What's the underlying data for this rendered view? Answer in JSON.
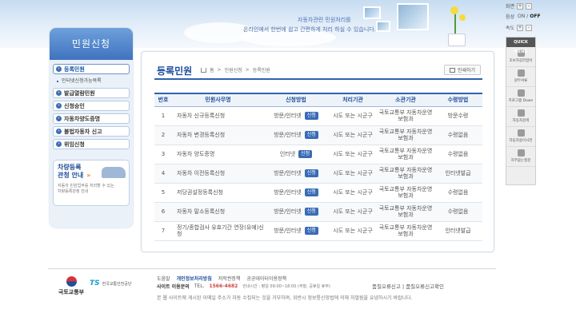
{
  "header": {
    "subtitle": "자동차관련 민원처리를",
    "headline": "온라인에서 한번에 쉽고 간편하게 처리 하실 수 있습니다."
  },
  "sidebar": {
    "title": "민원신청",
    "items": [
      {
        "label": "등록민원"
      },
      {
        "label": "발급열람민원"
      },
      {
        "label": "신청승인"
      },
      {
        "label": "자동차양도증명"
      },
      {
        "label": "불법자동차 신고"
      },
      {
        "label": "위임신청"
      }
    ],
    "sub_item": "인터넷신청가능목록",
    "promo": {
      "title_line1": "차량등록",
      "title_line2": "관청 안내",
      "arrow": "»",
      "desc_line1": "자동차 민원업무를 처리할 수 있는",
      "desc_line2": "차량등록관청 안내"
    }
  },
  "main": {
    "title": "등록민원",
    "breadcrumb": [
      "홈",
      ">",
      "민원신청",
      ">",
      "등록민원"
    ],
    "print_label": "인쇄하기",
    "apply_label": "신청",
    "columns": [
      "번호",
      "민원사무명",
      "신청방법",
      "처리기관",
      "소관기관",
      "수령방법"
    ],
    "rows": [
      {
        "no": "1",
        "name": "자동차 신규등록신청",
        "method": "방문/인터넷",
        "org": "시도 또는 시군구",
        "owner": "국토교통부 자동차운영보험과",
        "receive": "방문수령"
      },
      {
        "no": "2",
        "name": "자동차 변경등록신청",
        "method": "방문/인터넷",
        "org": "시도 또는 시군구",
        "owner": "국토교통부 자동차운영보험과",
        "receive": "수령없음"
      },
      {
        "no": "3",
        "name": "자동차 양도증명",
        "method": "인터넷",
        "org": "시도 또는 시군구",
        "owner": "국토교통부 자동차운영보험과",
        "receive": "수령없음"
      },
      {
        "no": "4",
        "name": "자동차 이전등록신청",
        "method": "방문/인터넷",
        "org": "시도 또는 시군구",
        "owner": "국토교통부 자동차운영보험과",
        "receive": "인터넷발급"
      },
      {
        "no": "5",
        "name": "저당권설정등록신청",
        "method": "방문/인터넷",
        "org": "시도 또는 시군구",
        "owner": "국토교통부 자동차운영보험과",
        "receive": "수령없음"
      },
      {
        "no": "6",
        "name": "자동차 말소등록신청",
        "method": "방문/인터넷",
        "org": "시도 또는 시군구",
        "owner": "국토교통부 자동차운영보험과",
        "receive": "수령없음"
      },
      {
        "no": "7",
        "name": "정기/종합검사 유효기간 연장(유예)신청",
        "method": "방문/인터넷",
        "org": "시도 또는 시군구",
        "owner": "국토교통부 자동차운영보험과",
        "receive": "인터넷발급"
      }
    ]
  },
  "rightbar": {
    "zoom_label": "화면",
    "plus": "+",
    "minus": "-",
    "voice_label": "음성",
    "voice_on": "ON",
    "voice_off": "OFF",
    "speed_label": "속도",
    "quick_title": "QUICK MENU",
    "quick_items": [
      "초보자길라잡이",
      "원부서류",
      "프로그램 Down",
      "자동차검색",
      "자동차용어사전",
      "자주묻는질문"
    ]
  },
  "footer": {
    "logo1": "국토교통부",
    "logo2_mark": "TS",
    "logo2_text": "한국교통안전공단",
    "links": [
      "도움말",
      "개인정보처리방침",
      "저작권정책",
      "공공데이터이용정책"
    ],
    "site_label": "사이트 이용문의",
    "tel_label": "TEL.",
    "tel": "1566-4682",
    "hours": "안내시간 : 평일 09:00~18:00 (주말, 공휴일 휴무)",
    "right_links": "품질오류신고 | 품질오류신고확인",
    "note": "본 웹 사이트에 게시된 이메일 주소가 자동 수집되는 것을 거부하며, 위반시 정보통신망법에 의해 처벌됨을 유념하시기 바랍니다."
  }
}
